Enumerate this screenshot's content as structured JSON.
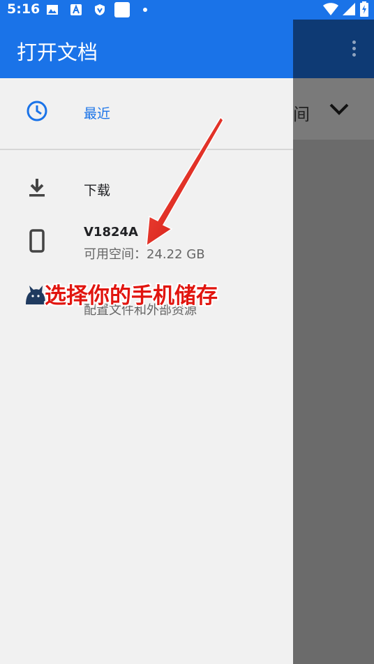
{
  "status_bar": {
    "time": "5:16"
  },
  "drawer": {
    "title": "打开文档",
    "items": [
      {
        "label": "最近",
        "icon": "clock-icon",
        "accent": "#1a73e8"
      },
      {
        "label": "下载",
        "icon": "download-icon"
      },
      {
        "label": "V1824A",
        "sub": "可用空间：24.22 GB",
        "icon": "phone-icon"
      },
      {
        "label": "",
        "sub": "配置文件和外部资源",
        "icon": "cat-icon"
      }
    ]
  },
  "background_app": {
    "partial_label": "间"
  },
  "annotation": {
    "text": "选择你的手机储存",
    "color": "#e1150f"
  },
  "colors": {
    "primary": "#1a73e8",
    "drawer_bg": "#f1f1f1",
    "scrim": "#6b6b6b"
  }
}
